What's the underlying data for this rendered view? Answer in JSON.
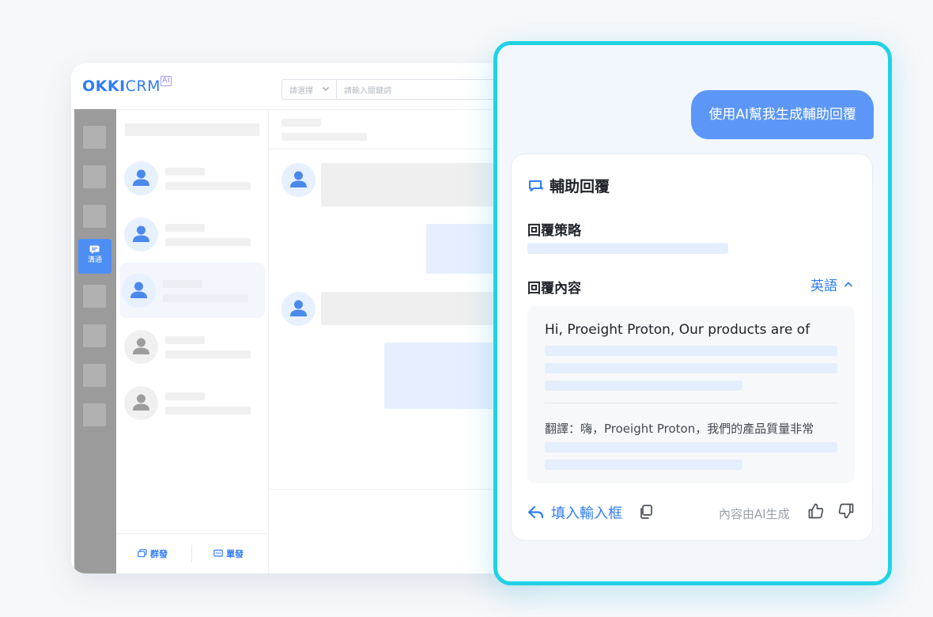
{
  "crm": {
    "logo": {
      "okki": "OKKI",
      "crm": "CRM",
      "ai": "AI"
    },
    "search": {
      "select_placeholder": "請選擇",
      "input_placeholder": "請輸入關鍵詞"
    },
    "rail": {
      "active_label": "溝通"
    },
    "footer": {
      "group_send": "群發",
      "single_send": "單發"
    }
  },
  "ai_panel": {
    "user_message": "使用AI幫我生成輔助回覆",
    "card_title": "輔助回覆",
    "strategy_label": "回覆策略",
    "content_label": "回覆內容",
    "language": "英語",
    "reply_text": "Hi, Proeight Proton, Our products are of",
    "translation_text": "翻譯：嗨，Proeight Proton，我們的產品質量非常",
    "fill_button": "填入輸入框",
    "ai_note": "內容由AI生成"
  },
  "colors": {
    "accent": "#2f7cf6",
    "panel_border": "#1fd3e3",
    "bubble": "#5c97f7",
    "rail_active": "#4d8ef5"
  }
}
